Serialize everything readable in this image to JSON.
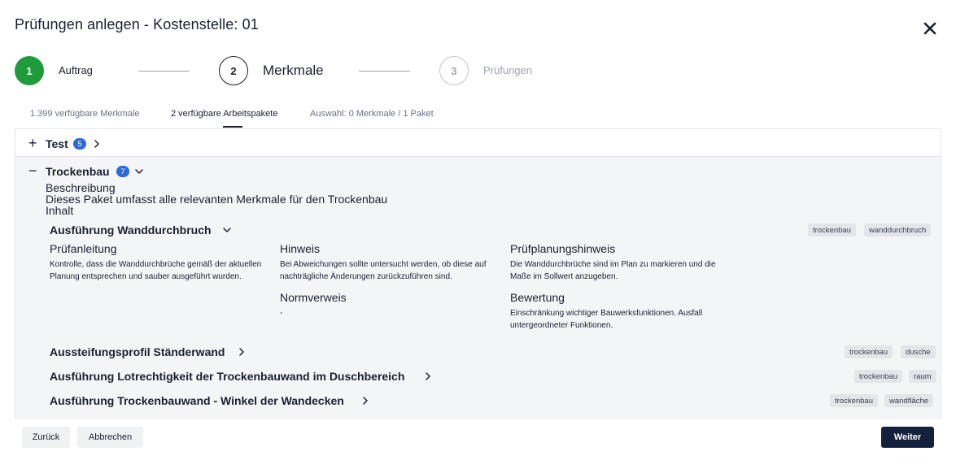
{
  "dialog": {
    "title": "Prüfungen anlegen - Kostenstelle: 01"
  },
  "stepper": {
    "steps": [
      {
        "number": "1",
        "label": "Auftrag"
      },
      {
        "number": "2",
        "label": "Merkmale"
      },
      {
        "number": "3",
        "label": "Prüfungen"
      }
    ]
  },
  "tabs": [
    {
      "label": "1.399 verfügbare Merkmale"
    },
    {
      "label": "2 verfügbare Arbeitspakete"
    },
    {
      "label": "Auswahl: 0 Merkmale / 1 Paket"
    }
  ],
  "packages": [
    {
      "sign": "+",
      "name": "Test",
      "count": "5"
    },
    {
      "sign": "−",
      "name": "Trockenbau",
      "count": "7",
      "description_label": "Beschreibung",
      "description": "Dieses Paket umfasst alle relevanten Merkmale für den Trockenbau",
      "content_label": "Inhalt",
      "items": [
        {
          "title": "Ausführung Wanddurchbruch",
          "tags": [
            "trockenbau",
            "wanddurchbruch"
          ],
          "details": {
            "pruefanleitung_label": "Prüfanleitung",
            "pruefanleitung": "Kontrolle, dass die Wanddurchbrüche gemäß der aktuellen Planung entsprechen und sauber ausgeführt wurden.",
            "hinweis_label": "Hinweis",
            "hinweis": "Bei Abweichungen sollte untersucht werden, ob diese auf nachträgliche Änderungen zurückzuführen sind.",
            "normverweis_label": "Normverweis",
            "normverweis": "-",
            "pruefplanungshinweis_label": "Prüfplanungshinweis",
            "pruefplanungshinweis": "Die Wanddurchbrüche sind im Plan zu markieren und die Maße im Sollwert anzugeben.",
            "bewertung_label": "Bewertung",
            "bewertung": "Einschränkung wichtiger Bauwerksfunktionen. Ausfall untergeordneter Funktionen."
          }
        },
        {
          "title": "Aussteifungsprofil Ständerwand",
          "tags": [
            "trockenbau",
            "dusche"
          ]
        },
        {
          "title": "Ausführung Lotrechtigkeit der Trockenbauwand im Duschbereich",
          "tags": [
            "trockenbau",
            "raum"
          ]
        },
        {
          "title": "Ausführung Trockenbauwand - Winkel der Wandecken",
          "tags": [
            "trockenbau",
            "wandfläche"
          ]
        }
      ]
    }
  ],
  "footer": {
    "back_label": "Zurück",
    "cancel_label": "Abbrechen",
    "next_label": "Weiter"
  },
  "colors": {
    "accent_done": "#1e9b3a",
    "badge": "#2d6bdc",
    "primary_button": "#14213d"
  },
  "icons": {
    "close": "close-icon",
    "chevron_right": "chevron-right-icon",
    "chevron_down": "chevron-down-icon"
  }
}
